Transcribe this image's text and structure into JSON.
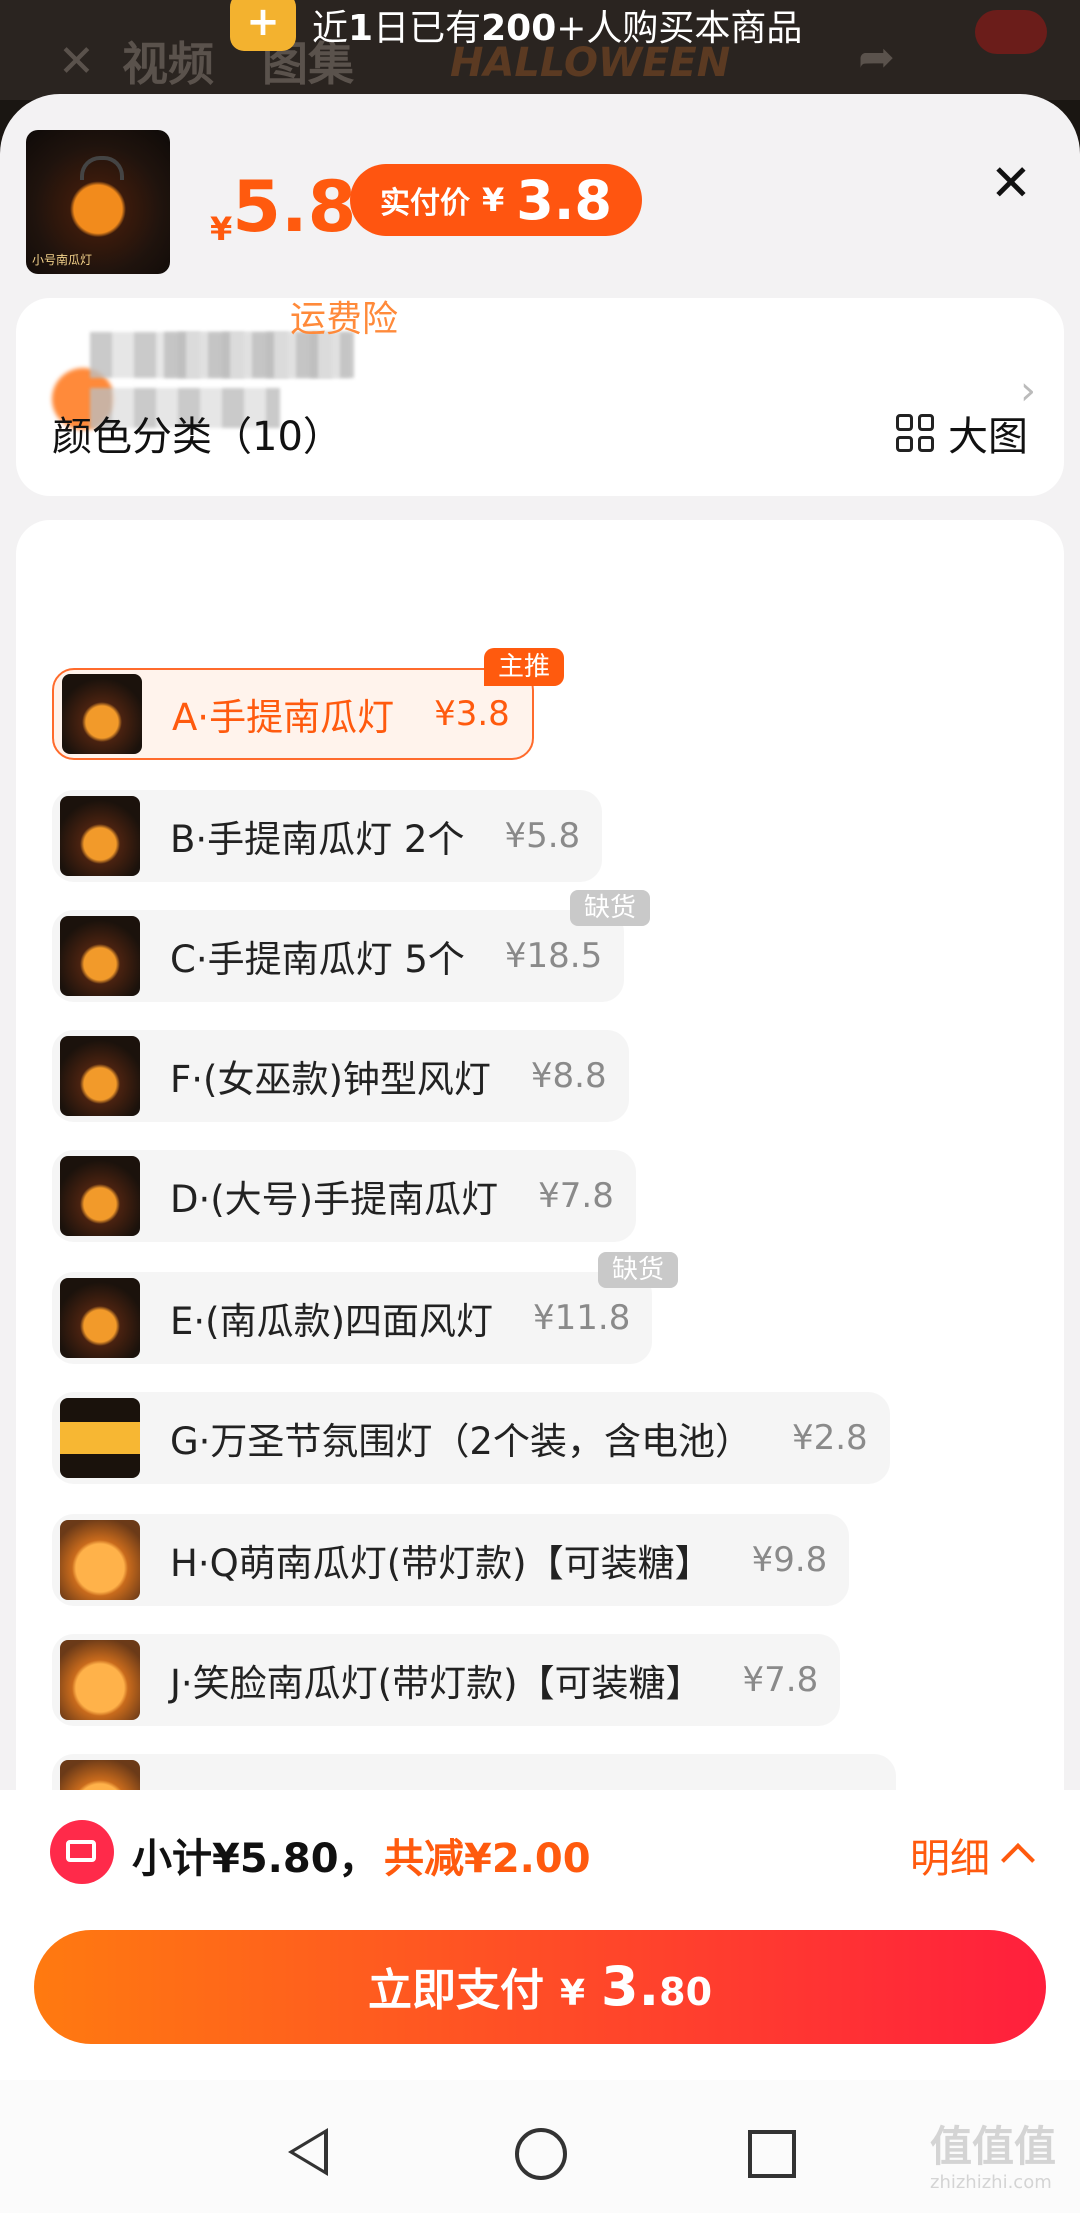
{
  "background": {
    "tabs": [
      "视频",
      "图集"
    ],
    "banner_art": "HALLOWEEN"
  },
  "banner": {
    "prefix": "近",
    "n1": "1",
    "mid": "日已有",
    "n2": "200",
    "suffix": "+人购买本商品"
  },
  "header": {
    "currency": "¥",
    "price": "5.8",
    "actual_label": "实付价",
    "actual_currency": "¥",
    "actual_price": "3.8",
    "thumb_caption": "小号南瓜灯"
  },
  "address": {
    "visible_text": "运费险"
  },
  "options_section": {
    "title": "颜色分类（10）",
    "big_pic_label": "大图",
    "options": [
      {
        "label": "A·手提南瓜灯",
        "price": "¥3.8",
        "badge": "主推"
      },
      {
        "label": "B·手提南瓜灯 2个",
        "price": "¥5.8"
      },
      {
        "label": "C·手提南瓜灯 5个",
        "price": "¥18.5",
        "badge": "缺货"
      },
      {
        "label": "F·(女巫款)钟型风灯",
        "price": "¥8.8"
      },
      {
        "label": "D·(大号)手提南瓜灯",
        "price": "¥7.8"
      },
      {
        "label": "E·(南瓜款)四面风灯",
        "price": "¥11.8",
        "badge": "缺货"
      },
      {
        "label": "G·万圣节氛围灯（2个装，含电池）",
        "price": "¥2.8"
      },
      {
        "label": "H·Q萌南瓜灯(带灯款)【可装糖】",
        "price": "¥9.8"
      },
      {
        "label": "J·笑脸南瓜灯(带灯款)【可装糖】",
        "price": "¥7.8"
      }
    ]
  },
  "footer": {
    "subtotal": "小计¥5.80，",
    "discount": "共减¥2.00",
    "detail_label": "明细",
    "pay_label": "立即支付",
    "pay_currency": "¥",
    "pay_int": "3.",
    "pay_dec": "80"
  },
  "watermark": {
    "main": "值值值",
    "sub": "zhizhizhi.com"
  },
  "colors": {
    "accent": "#ff5a0e",
    "pay_gradient_start": "#ff7a10",
    "pay_gradient_end": "#ff1f3d",
    "out_of_stock": "#c9c9c9"
  }
}
